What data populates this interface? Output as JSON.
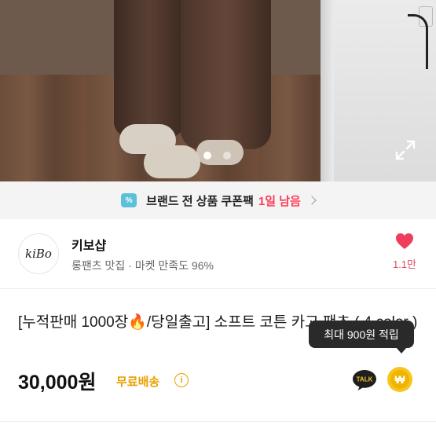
{
  "coupon": {
    "icon_text": "%",
    "text": "브랜드 전 상품 쿠폰팩",
    "remaining": "1일 남음",
    "accent_color": "#ff3b56"
  },
  "gallery": {
    "slide_count": 2,
    "active_index": 0,
    "icons": [
      "expand-icon"
    ]
  },
  "shop": {
    "logo_text": "kiBo",
    "name": "키보샵",
    "meta": "롱팬츠 맛집 · 마켓 만족도 96%",
    "like_count": "1.1만",
    "like_color": "#e24a5e"
  },
  "product": {
    "title": "[누적판매 1000장🔥/당일출고] 소프트 코튼 카고 팬츠 ( 4 color )",
    "price": "30,000원",
    "shipping": "무료배송",
    "shipping_color": "#e8a000",
    "points_tooltip": "최대 900원 적립",
    "talk_label": "TALK",
    "pay_symbol": "₩"
  }
}
